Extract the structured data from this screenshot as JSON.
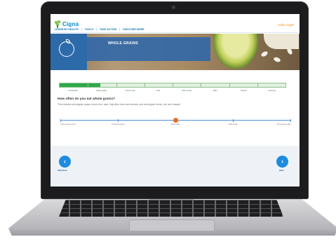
{
  "site": {
    "brand": "Cigna",
    "greeting": "Hello Angel",
    "nav": [
      {
        "label": "LEARN BY HEALTH"
      },
      {
        "label": "TOOLS"
      },
      {
        "label": "TAKE ACTION"
      },
      {
        "label": "DISCOVER MORE"
      }
    ]
  },
  "hero": {
    "title": "WHOLE GRAINS"
  },
  "progress": {
    "completed_fraction": 0.18,
    "steps": [
      {
        "label": "Introduction"
      },
      {
        "label": "Whole grains"
      },
      {
        "label": "Fruits & veg"
      },
      {
        "label": "Fats"
      },
      {
        "label": "Fish & meat"
      },
      {
        "label": "Dairy"
      },
      {
        "label": "Snacks"
      },
      {
        "label": "Summary"
      }
    ]
  },
  "question": {
    "text": "How often do you eat whole grains?",
    "hint": "This includes wholegrain pasta, brown rice, oats, high-fibre bran and cereals, and wholegrain bread, roti, and chapati"
  },
  "answer_slider": {
    "selected_index": 2,
    "options": [
      {
        "label": "Once a week or less"
      },
      {
        "label": "2-3 times a week"
      },
      {
        "label": "Once a day"
      },
      {
        "label": "Twice a day"
      },
      {
        "label": "Three times a day"
      }
    ]
  },
  "footer": {
    "previous_label": "PREVIOUS",
    "next_label": "NEXT",
    "previous_glyph": "‹",
    "next_glyph": "›"
  },
  "colors": {
    "brand_blue": "#0088c6",
    "progress_green": "#2fa84a",
    "slider_handle": "#f06a1f",
    "button_blue": "#1c8be0",
    "greeting_orange": "#f28c1e"
  },
  "icons": {
    "logo": "cigna-tree-icon",
    "hero": "apple-outline-icon",
    "previous": "chevron-left-icon",
    "next": "chevron-right-icon"
  }
}
